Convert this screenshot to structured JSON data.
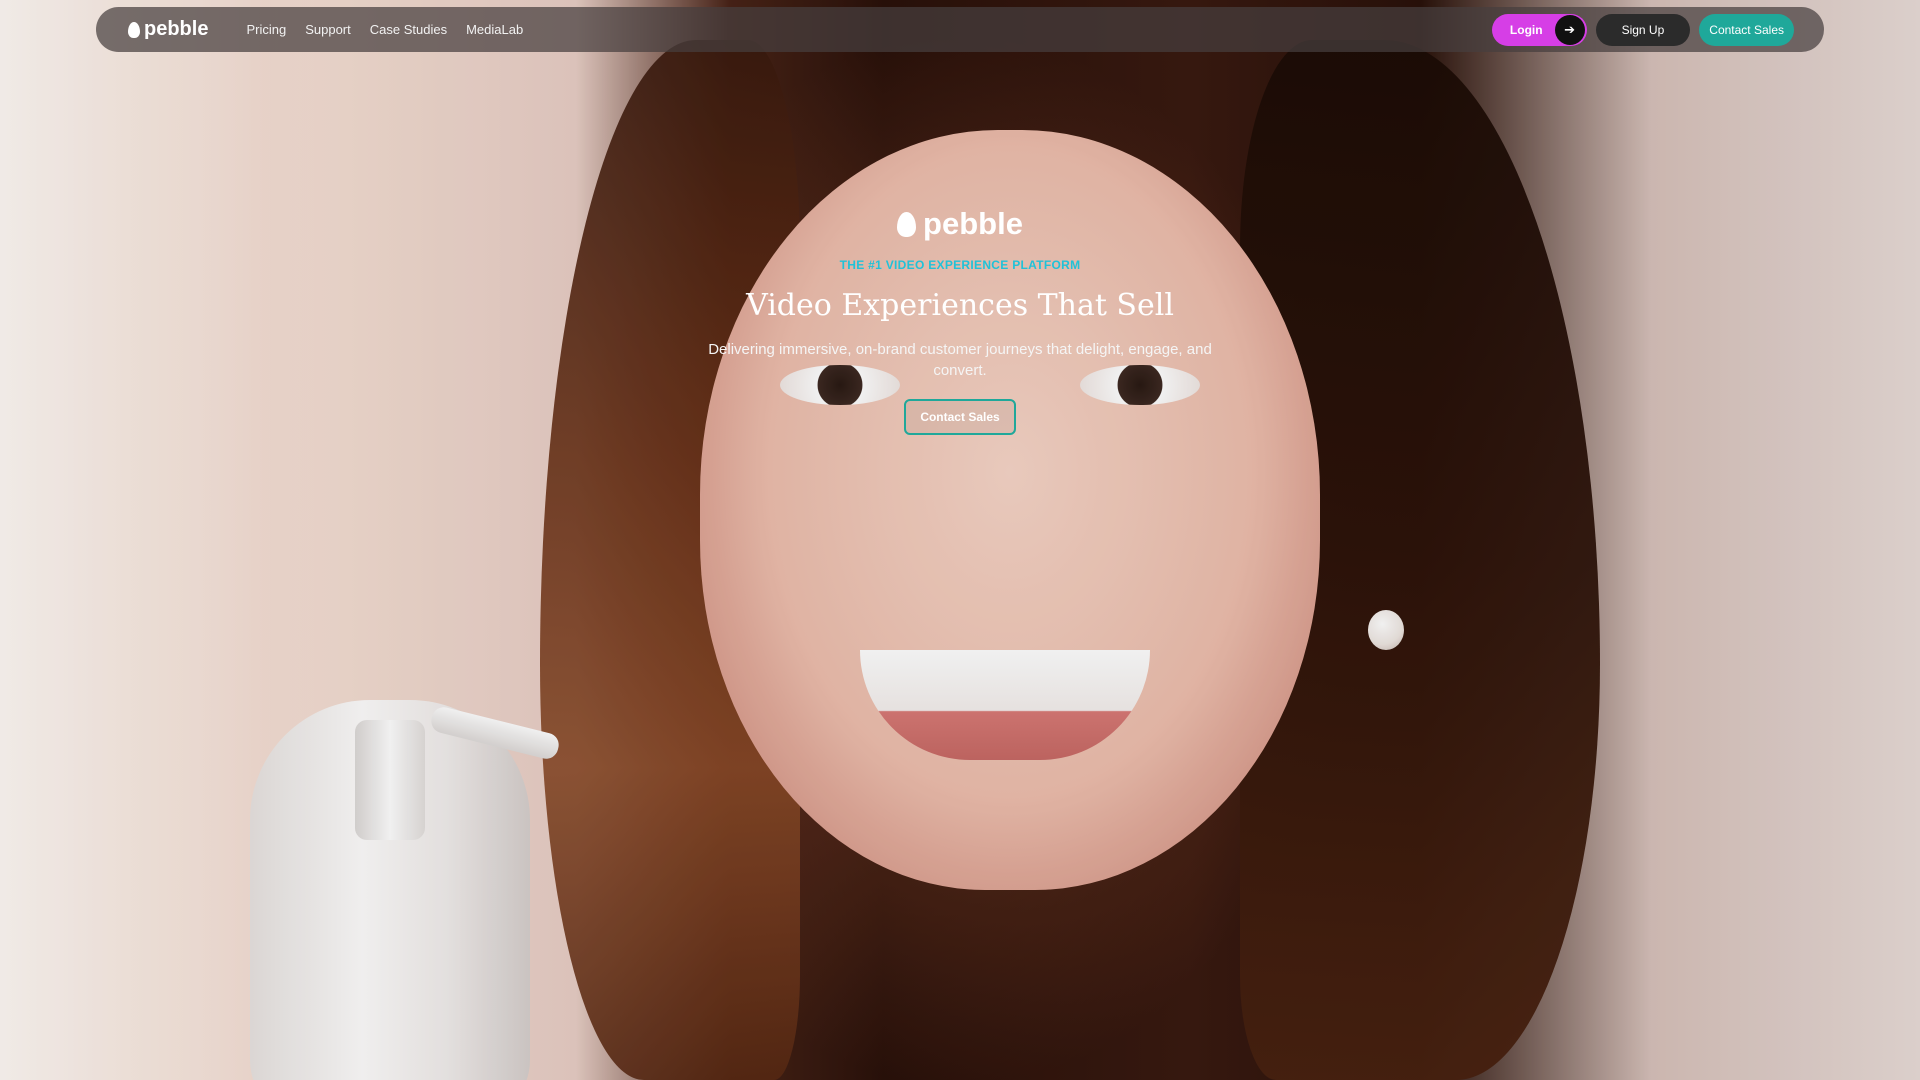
{
  "brand": {
    "name": "pebble",
    "accent_magenta": "#d63ee6",
    "accent_teal": "#1fa89a",
    "accent_cyan": "#20c2d8"
  },
  "nav": {
    "links": [
      {
        "label": "Pricing"
      },
      {
        "label": "Support"
      },
      {
        "label": "Case Studies"
      },
      {
        "label": "MediaLab"
      }
    ],
    "login_label": "Login",
    "login_icon": "arrow-right-icon",
    "signup_label": "Sign Up",
    "contact_label": "Contact Sales"
  },
  "hero": {
    "eyebrow": "THE #1 VIDEO EXPERIENCE PLATFORM",
    "headline": "Video Experiences That Sell",
    "subheadline": "Delivering immersive, on-brand customer journeys that delight, engage, and convert.",
    "cta_label": "Contact Sales"
  }
}
